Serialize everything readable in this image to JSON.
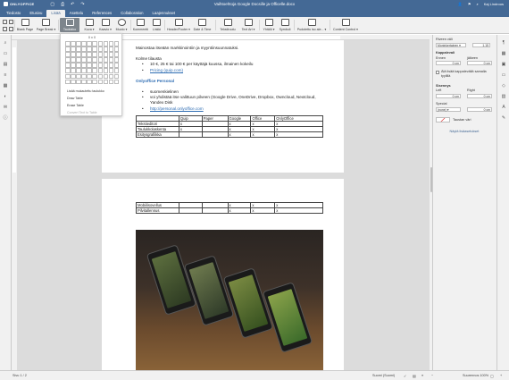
{
  "app": {
    "brand": "ONLYOFFICE",
    "doc_title": "Vaihtoehtoja Google Docsille ja Officelle.docx",
    "user": "Kaj Lindroos"
  },
  "tabs": [
    {
      "label": "Tiedosto"
    },
    {
      "label": "Etusivu"
    },
    {
      "label": "Lisää"
    },
    {
      "label": "Asettelu"
    },
    {
      "label": "References"
    },
    {
      "label": "Collaboration"
    },
    {
      "label": "Laajennukset"
    }
  ],
  "toolbar": {
    "blank_page": "Blank Page",
    "page_break": "Page Break ▾",
    "table": "Taulukko",
    "image": "Kuva ▾",
    "chart": "Kaavio ▾",
    "shape": "Muoto ▾",
    "comment": "Kommentti",
    "link": "Linkki",
    "header_footer": "Header/Footer ▾",
    "date_time": "Date & Time",
    "textbox": "Tekstiruutu",
    "textart": "Text Art ▾",
    "equation": "Yhtälö ▾",
    "symbol": "Symboli",
    "dropcap": "Pudotettu iso ale... ▾",
    "content_control": "Content Control ▾"
  },
  "table_menu": {
    "size": "0 x 0",
    "items": [
      "Lisää mukautettu taulukko",
      "Draw Table",
      "Erase Table",
      "Convert Text to Table"
    ]
  },
  "document": {
    "p1": "Mainostaa itseään markkinointiin ja myyntiinsuunnatuksi.",
    "kolme_title": "Kolme tilausta",
    "kolme_items": [
      "10 €, 25 € tai 100 € per käyttäjä kuussa, ilmainen kokeilu"
    ],
    "kolme_link": "Pricing (quip.com)",
    "heading": "Onlyoffice Personal",
    "oo_items": [
      "suomenkielinen",
      "voi yhdistää itse valittuun pilveen (Google Drive, OneDrive, Dropbox, Owncloud, Nextcloud, Yandex Disk"
    ],
    "oo_link": "http://personal.onlyoffice.com",
    "table_header": [
      "",
      "Quip",
      "Paper",
      "Google",
      "Office",
      "OnlyOffice"
    ],
    "table_rows": [
      [
        "Tekstieditori",
        "x",
        "",
        "x",
        "x",
        "x"
      ],
      [
        "Taulukkolaskenta",
        "x",
        "",
        "x",
        "x",
        "x"
      ],
      [
        "Esitysgrafiikka",
        "",
        "",
        "x",
        "x",
        "x"
      ]
    ],
    "table2_rows": [
      [
        "Mobiilisovellus",
        "",
        "",
        "x",
        "x",
        "x"
      ],
      [
        "Pilvitallennus",
        "",
        "",
        "x",
        "x",
        "x"
      ]
    ]
  },
  "right_panel": {
    "row_height_label": "Riveen väli",
    "row_height_mode": "Moninkertainen ▾",
    "row_height_value": "1.15",
    "spacing_label": "Kappalevali",
    "before_label": "Ennen",
    "before_value": "0 cm",
    "after_label": "jälkeen",
    "after_value": "0 cm",
    "no_space_label": "Älä lisää kappaleväliä samalla tyylillä",
    "indent_label": "Sisennys",
    "left_label": "Left",
    "left_value": "0 cm",
    "right_label": "Right",
    "right_value": "0 cm",
    "special_label": "Special",
    "special_mode": "(none) ▾",
    "special_value": "0 cm",
    "bg_color_label": "Taustan väri",
    "advanced_label": "Näytä lisäasetukset"
  },
  "status": {
    "page": "Sivu 1 / 2",
    "language": "Suomi (Suomi)",
    "zoom": "Suurennos 100%"
  }
}
